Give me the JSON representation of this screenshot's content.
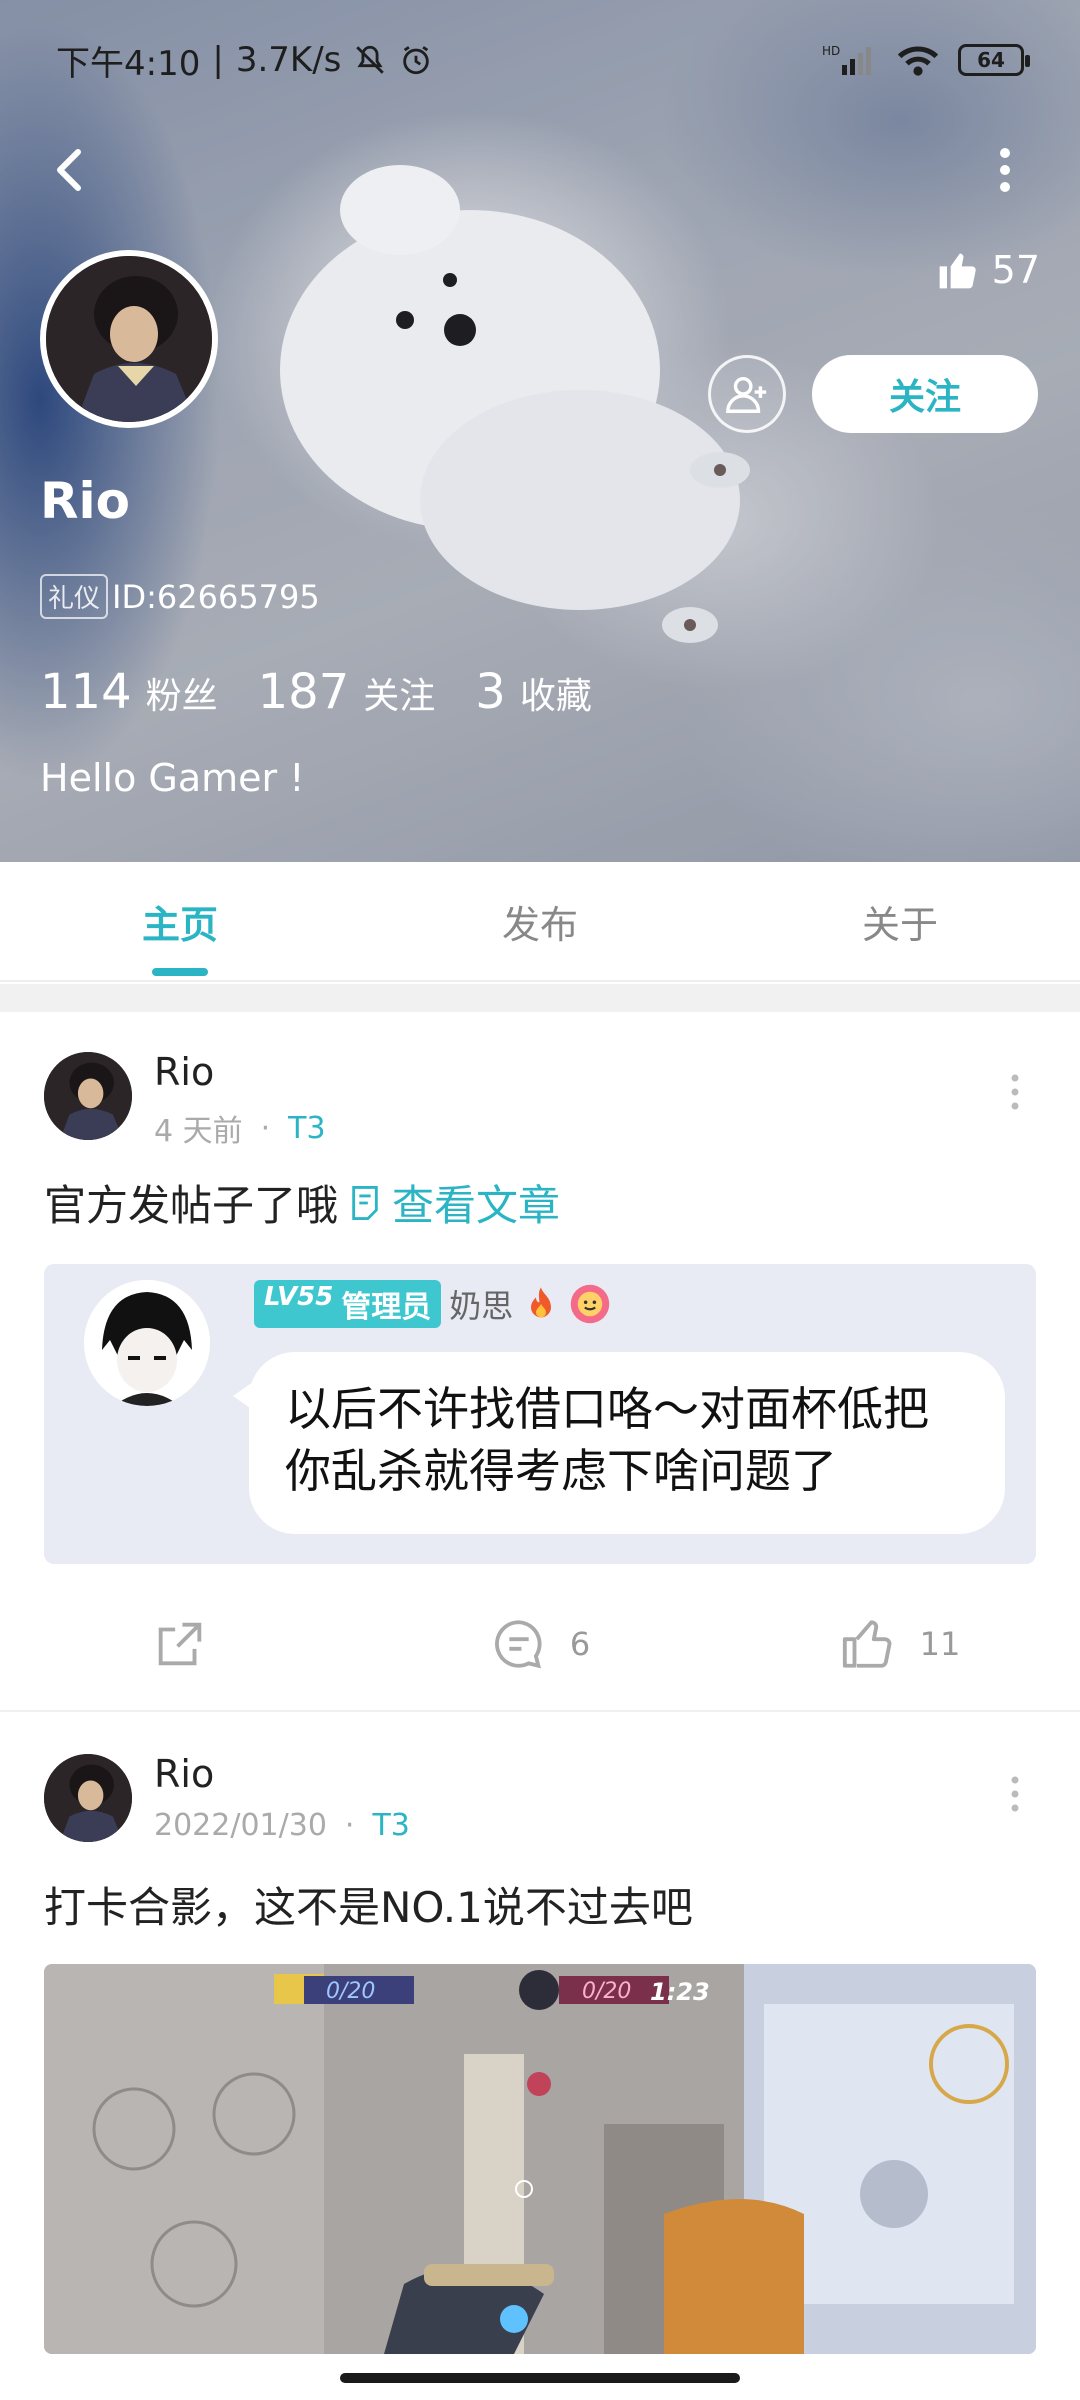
{
  "status_bar": {
    "time": "下午4:10",
    "net_speed": "3.7K/s",
    "battery": "64"
  },
  "profile": {
    "likes_count": "57",
    "follow_label": "关注",
    "username": "Rio",
    "badge": "礼仪",
    "id": "ID:62665795",
    "stats": [
      {
        "num": "114",
        "label": "粉丝"
      },
      {
        "num": "187",
        "label": "关注"
      },
      {
        "num": "3",
        "label": "收藏"
      }
    ],
    "bio": "Hello Gamer !"
  },
  "tabs": [
    {
      "label": "主页",
      "active": true
    },
    {
      "label": "发布",
      "active": false
    },
    {
      "label": "关于",
      "active": false
    }
  ],
  "posts": [
    {
      "author": "Rio",
      "time": "4 天前",
      "tag": "T3",
      "text": "官方发帖子了哦",
      "link": "查看文章",
      "quote": {
        "level": "LV55",
        "role": "管理员",
        "name": "奶思",
        "message": "以后不许找借口咯～对面杯低把你乱杀就得考虑下啥问题了"
      },
      "comments": "6",
      "likes": "11"
    },
    {
      "author": "Rio",
      "time": "2022/01/30",
      "tag": "T3",
      "text": "打卡合影，这不是NO.1说不过去吧",
      "game": {
        "score_left": "0/20",
        "score_right": "0/20",
        "timer": "1:23"
      }
    }
  ],
  "colors": {
    "accent": "#2bb5c4"
  }
}
